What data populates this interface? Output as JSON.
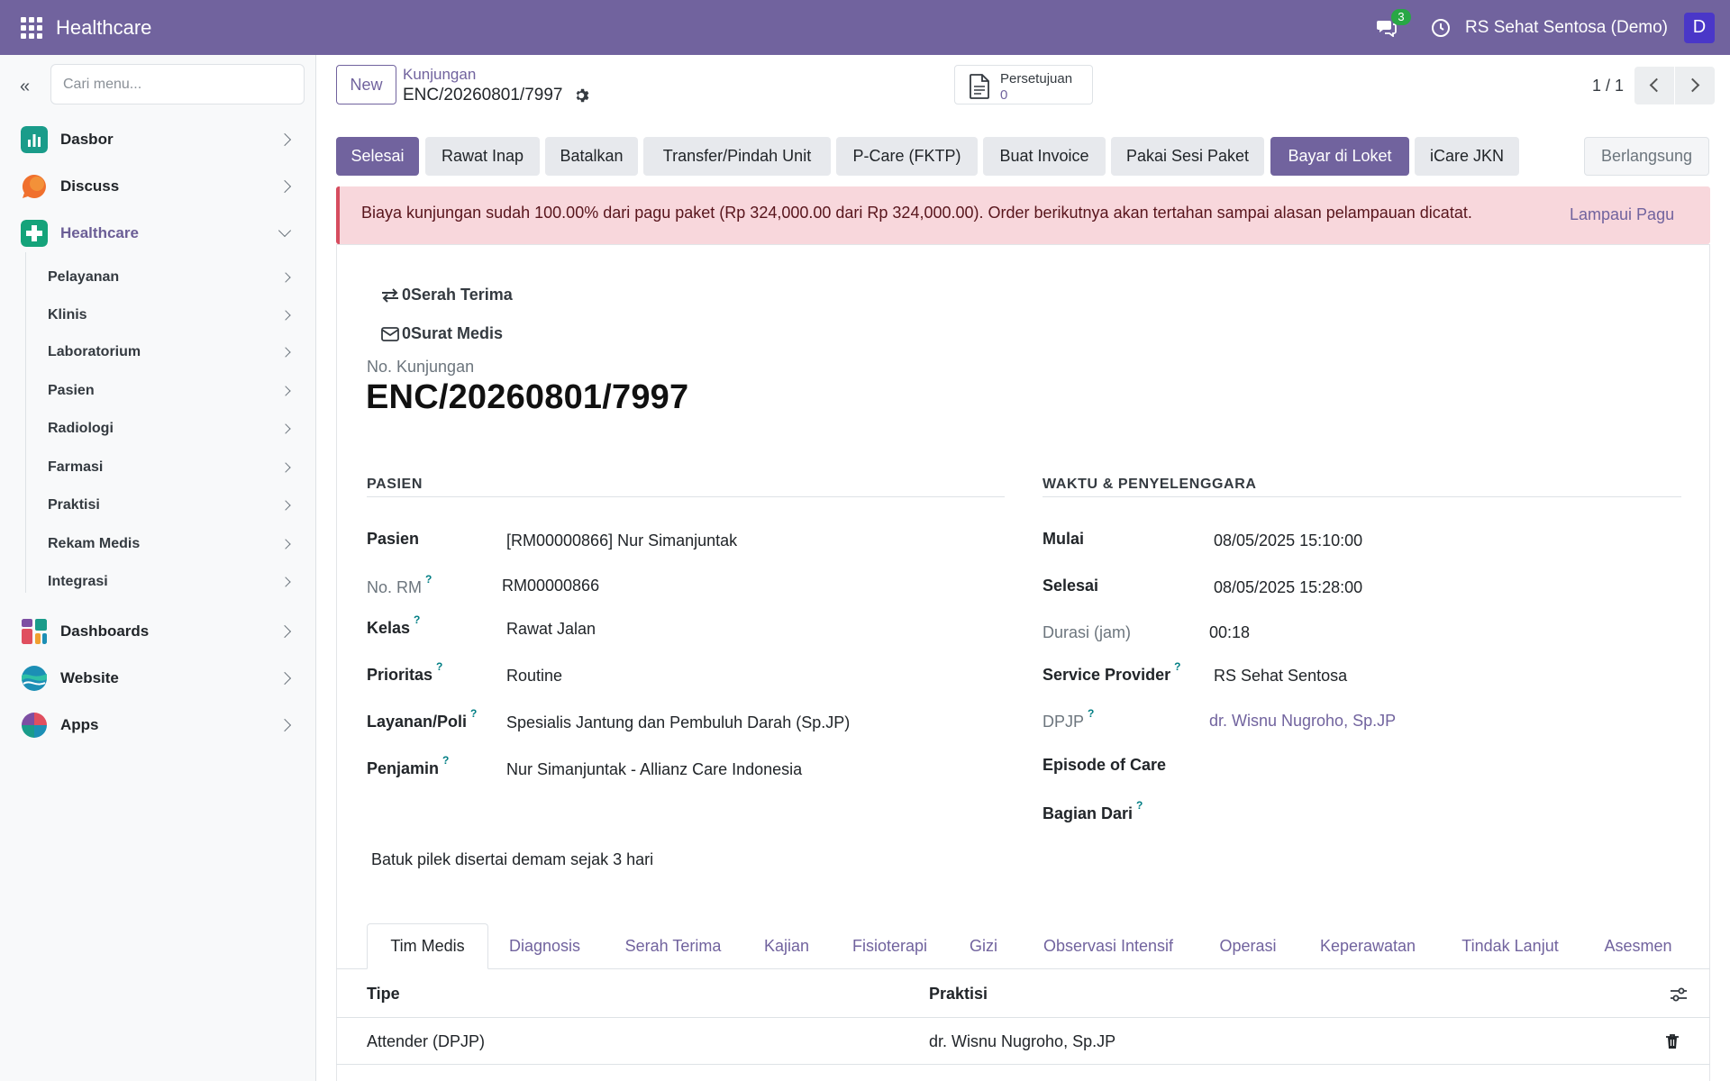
{
  "app": {
    "brand": "Healthcare",
    "chat_count": "3",
    "company": "RS Sehat Sentosa (Demo)",
    "avatar_letter": "D"
  },
  "sidebar": {
    "search_placeholder": "Cari menu...",
    "items": [
      {
        "label": "Dasbor",
        "icon": "chart-icon",
        "color": "#1a9c8a"
      },
      {
        "label": "Discuss",
        "icon": "discuss-icon",
        "color": "#f0702d"
      },
      {
        "label": "Healthcare",
        "icon": "healthcare-icon",
        "color": "#15a37a"
      },
      {
        "label": "Dashboards",
        "icon": "dashboards-icon",
        "color": "#7d4fa3"
      },
      {
        "label": "Website",
        "icon": "website-icon",
        "color": "#1c8fb5"
      },
      {
        "label": "Apps",
        "icon": "apps-icon",
        "color": "#e04f5f"
      }
    ],
    "sub_items": [
      "Pelayanan",
      "Klinis",
      "Laboratorium",
      "Pasien",
      "Radiologi",
      "Farmasi",
      "Praktisi",
      "Rekam Medis",
      "Integrasi"
    ]
  },
  "control": {
    "new_label": "New",
    "breadcrumb_parent": "Kunjungan",
    "breadcrumb_current": "ENC/20260801/7997",
    "approval_label": "Persetujuan",
    "approval_count": "0",
    "pager": "1 / 1"
  },
  "statusbar": {
    "buttons": [
      "Selesai",
      "Rawat Inap",
      "Batalkan",
      "Transfer/Pindah Unit",
      "P-Care (FKTP)",
      "Buat Invoice",
      "Pakai Sesi Paket",
      "Bayar di Loket",
      "iCare JKN"
    ],
    "state": "Berlangsung"
  },
  "alert": {
    "message": "Biaya kunjungan sudah 100.00% dari pagu paket (Rp 324,000.00 dari Rp 324,000.00). Order berikutnya akan tertahan sampai alasan pelampauan dicatat.",
    "link": "Lampaui Pagu"
  },
  "sheet": {
    "smart_handover": {
      "count": "0",
      "label": "Serah Terima"
    },
    "smart_letters": {
      "count": "0",
      "label": "Surat Medis"
    },
    "name_label": "No. Kunjungan",
    "name": "ENC/20260801/7997",
    "group_left_title": "PASIEN",
    "group_right_title": "WAKTU & PENYELENGGARA",
    "left_fields": [
      {
        "label": "Pasien",
        "value": "[RM00000866] Nur Simanjuntak"
      },
      {
        "label": "No. RM",
        "value": "RM00000866"
      },
      {
        "label": "Kelas",
        "value": "Rawat Jalan"
      },
      {
        "label": "Prioritas",
        "value": "Routine"
      },
      {
        "label": "Layanan/Poli",
        "value": "Spesialis Jantung dan Pembuluh Darah (Sp.JP)"
      },
      {
        "label": "Penjamin",
        "value": "Nur Simanjuntak - Allianz Care Indonesia"
      }
    ],
    "right_fields": [
      {
        "label": "Mulai",
        "value": "08/05/2025 15:10:00"
      },
      {
        "label": "Selesai",
        "value": "08/05/2025 15:28:00"
      },
      {
        "label": "Durasi (jam)",
        "value": "00:18"
      },
      {
        "label": "Service Provider",
        "value": "RS Sehat Sentosa"
      },
      {
        "label": "DPJP",
        "value": "dr. Wisnu Nugroho, Sp.JP"
      },
      {
        "label": "Episode of Care",
        "value": ""
      },
      {
        "label": "Bagian Dari",
        "value": ""
      }
    ],
    "note": "Batuk pilek disertai demam sejak 3 hari"
  },
  "notebook": {
    "tabs": [
      "Tim Medis",
      "Diagnosis",
      "Serah Terima",
      "Kajian",
      "Fisioterapi",
      "Gizi",
      "Observasi Intensif",
      "Operasi",
      "Keperawatan",
      "Tindak Lanjut",
      "Asesmen"
    ],
    "columns": [
      "Tipe",
      "Praktisi"
    ],
    "rows": [
      [
        "Attender (DPJP)",
        "dr. Wisnu Nugroho, Sp.JP"
      ]
    ]
  }
}
